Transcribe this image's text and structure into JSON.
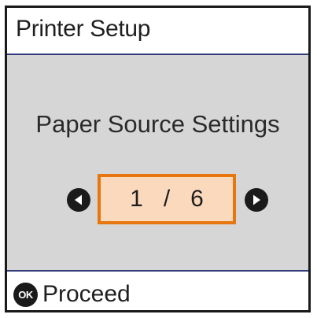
{
  "header": {
    "title": "Printer Setup"
  },
  "main": {
    "setting_title": "Paper Source Settings",
    "pager": {
      "current": "1",
      "separator": "/",
      "total": "6"
    }
  },
  "footer": {
    "ok_icon_text": "OK",
    "action_label": "Proceed"
  },
  "colors": {
    "accent_border": "#e8760f",
    "highlight_fill": "#fbd9bd",
    "divider": "#2f3b7a",
    "panel_bg": "#d6d6d6"
  },
  "icons": {
    "prev": "arrow-left-icon",
    "next": "arrow-right-icon",
    "ok": "ok-button-icon"
  }
}
